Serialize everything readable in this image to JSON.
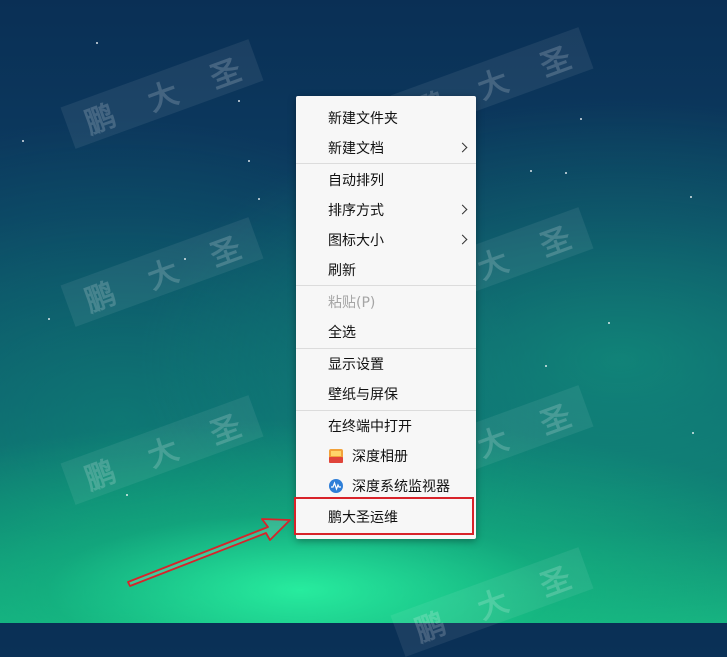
{
  "desktop": {
    "watermark_chars": [
      "鹏",
      "大",
      "圣"
    ]
  },
  "context_menu": {
    "items": [
      {
        "label": "新建文件夹"
      },
      {
        "label": "新建文档"
      },
      {
        "label": "自动排列"
      },
      {
        "label": "排序方式"
      },
      {
        "label": "图标大小"
      },
      {
        "label": "刷新"
      },
      {
        "label": "粘贴(P)"
      },
      {
        "label": "全选"
      },
      {
        "label": "显示设置"
      },
      {
        "label": "壁纸与屏保"
      },
      {
        "label": "在终端中打开"
      },
      {
        "label": "深度相册"
      },
      {
        "label": "深度系统监视器"
      },
      {
        "label": "鹏大圣运维"
      }
    ]
  },
  "colors": {
    "menu_bg": "#f7f7f7",
    "highlight_border": "#d8232a",
    "annotation_arrow": "#d8232a"
  }
}
